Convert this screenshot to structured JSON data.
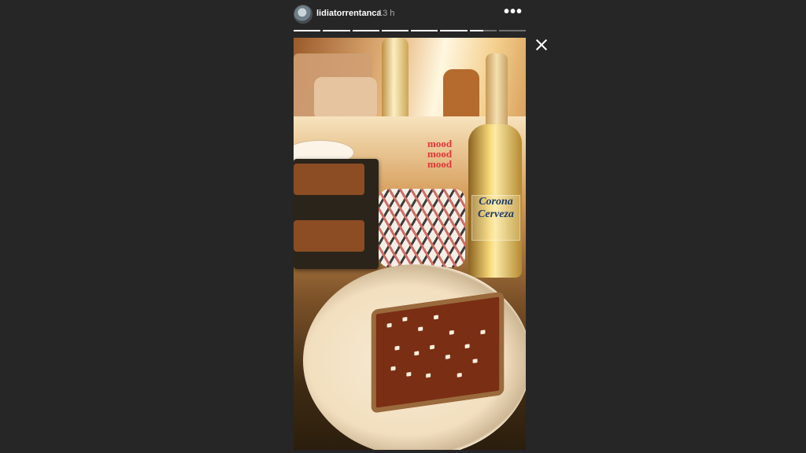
{
  "header": {
    "username": "lidiatorrentanca",
    "timestamp": "13 h",
    "more_icon": "more-horizontal-icon",
    "avatar_icon": "user-avatar"
  },
  "progress": {
    "segments": 8,
    "completed": 6,
    "current_fraction": 0.5
  },
  "story": {
    "sticker_lines": [
      "mood",
      "mood",
      "mood"
    ],
    "bottle_label": [
      "Corona",
      "Cerveza"
    ]
  },
  "close_icon": "close-icon",
  "colors": {
    "background": "#262626",
    "sticker": "#e2353b",
    "progress_active": "#ffffff",
    "progress_inactive": "rgba(255,255,255,0.35)"
  }
}
